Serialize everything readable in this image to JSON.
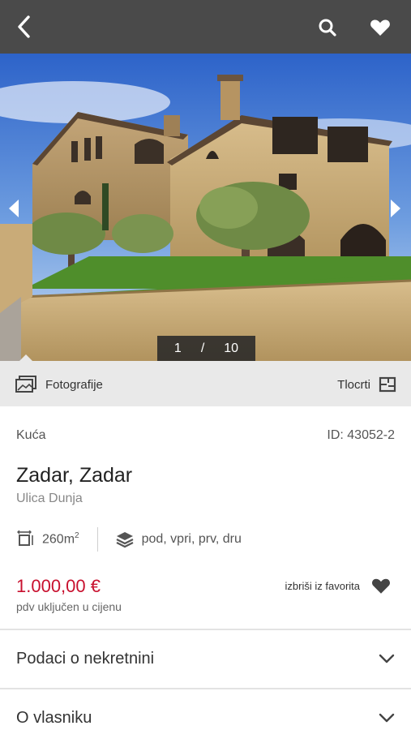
{
  "header": {
    "back_icon": "chevron-left-icon",
    "search_icon": "search-icon",
    "favorite_icon": "heart-icon",
    "background": "#4a4a4a"
  },
  "gallery": {
    "current": "1",
    "separator": "/",
    "total": "10"
  },
  "tabs": {
    "photos_label": "Fotografije",
    "plans_label": "Tlocrti"
  },
  "listing": {
    "type": "Kuća",
    "id": "ID: 43052-2",
    "title": "Zadar, Zadar",
    "street": "Ulica Dunja",
    "area_value": "260m",
    "area_exp": "2",
    "floors": "pod, vpri, prv, dru",
    "price": "1.000,00 €",
    "vat_note": "pdv uključen u cijenu",
    "remove_favorite": "izbriši iz favorita",
    "price_color": "#c8102e"
  },
  "sections": [
    {
      "label": "Podaci o nekretnini"
    },
    {
      "label": "O vlasniku"
    }
  ]
}
